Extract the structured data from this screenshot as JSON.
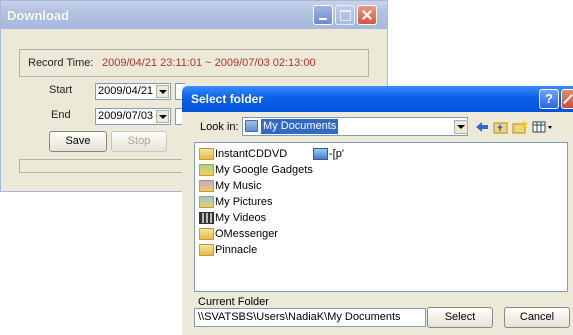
{
  "download": {
    "title": "Download",
    "record_time_label": "Record Time:",
    "record_time_value": "2009/04/21 23:11:01 ~ 2009/07/03 02:13:00",
    "start_label": "Start",
    "start_value": "2009/04/21",
    "end_label": "End",
    "end_value": "2009/07/03",
    "save_label": "Save",
    "stop_label": "Stop"
  },
  "select_folder": {
    "title": "Select folder",
    "help_label": "?",
    "look_in_label": "Look in:",
    "look_in_value": "My Documents",
    "items": [
      {
        "label": "InstantCDDVD",
        "icon": "folder-icon"
      },
      {
        "label": "My Google Gadgets",
        "icon": "special-folder-icon"
      },
      {
        "label": "My Music",
        "icon": "music-folder-icon"
      },
      {
        "label": "My Pictures",
        "icon": "pictures-folder-icon"
      },
      {
        "label": "My Videos",
        "icon": "video-folder-icon"
      },
      {
        "label": "OMessenger",
        "icon": "folder-icon"
      },
      {
        "label": "Pinnacle",
        "icon": "folder-icon"
      },
      {
        "label": "-[p'",
        "icon": "shortcut-icon"
      }
    ],
    "current_folder_label": "Current Folder",
    "current_folder_value": "\\\\SVATSBS\\Users\\NadiaK\\My Documents",
    "select_label": "Select",
    "cancel_label": "Cancel"
  },
  "colors": {
    "record_time_value": "#b2332a",
    "dialog_titlebar": "#0a5fe8",
    "selection": "#316ac5"
  }
}
